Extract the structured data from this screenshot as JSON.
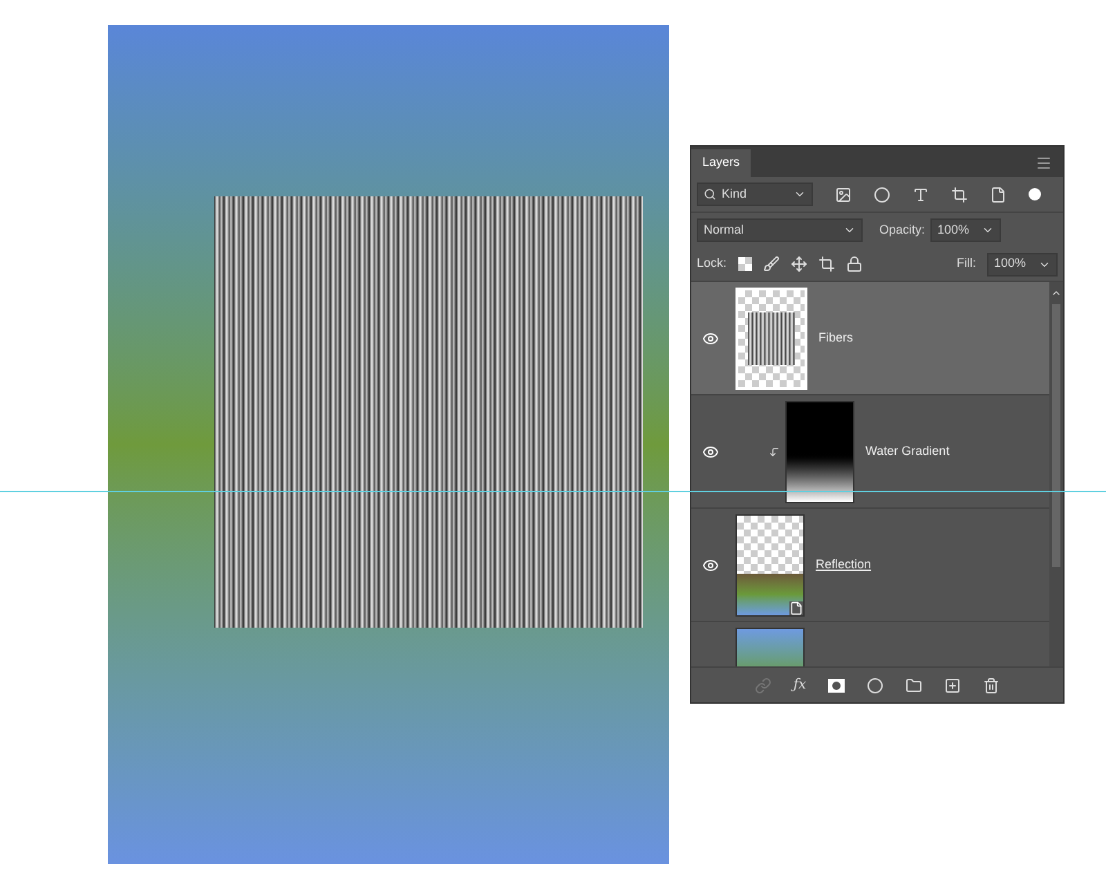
{
  "panel": {
    "tab": "Layers",
    "filter": {
      "value": "Kind"
    },
    "blend_mode": {
      "value": "Normal"
    },
    "opacity": {
      "label": "Opacity:",
      "value": "100%"
    },
    "lock": {
      "label": "Lock:"
    },
    "fill": {
      "label": "Fill:",
      "value": "100%"
    },
    "effects_button": "ƒx"
  },
  "layers": [
    {
      "name": "Fibers",
      "kind": "fibers",
      "visible": true,
      "selected": true,
      "clipped": false,
      "smart_object": false
    },
    {
      "name": "Water Gradient",
      "kind": "gradient",
      "visible": true,
      "selected": false,
      "clipped": true,
      "smart_object": false
    },
    {
      "name": "Reflection",
      "kind": "photo",
      "visible": true,
      "selected": false,
      "clipped": false,
      "smart_object": true
    },
    {
      "kind": "image",
      "selected": false
    }
  ]
}
